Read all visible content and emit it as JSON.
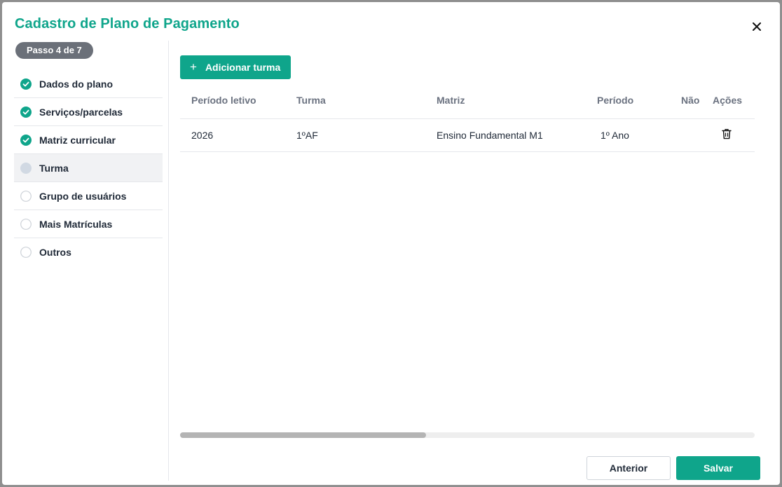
{
  "dialog": {
    "title": "Cadastro de Plano de Pagamento",
    "close_icon": "close-icon"
  },
  "wizard": {
    "step_badge": "Passo 4 de 7",
    "steps": [
      {
        "label": "Dados do plano",
        "status": "done"
      },
      {
        "label": "Serviços/parcelas",
        "status": "done"
      },
      {
        "label": "Matriz curricular",
        "status": "done"
      },
      {
        "label": "Turma",
        "status": "current"
      },
      {
        "label": "Grupo de usuários",
        "status": "pending"
      },
      {
        "label": "Mais Matrículas",
        "status": "pending"
      },
      {
        "label": "Outros",
        "status": "pending"
      }
    ]
  },
  "toolbar": {
    "add_label": "Adicionar turma",
    "add_icon": "plus-icon"
  },
  "table": {
    "columns": [
      "Período letivo",
      "Turma",
      "Matriz",
      "Período",
      "Não",
      "Ações"
    ],
    "rows": [
      {
        "periodo_letivo": "2026",
        "turma": "1ºAF",
        "matriz": "Ensino Fundamental M1",
        "periodo": "1º Ano",
        "nao": "",
        "acao_icon": "trash-icon"
      }
    ]
  },
  "footer": {
    "prev_label": "Anterior",
    "save_label": "Salvar"
  },
  "colors": {
    "accent": "#0fa58b",
    "badge": "#6b7079"
  }
}
